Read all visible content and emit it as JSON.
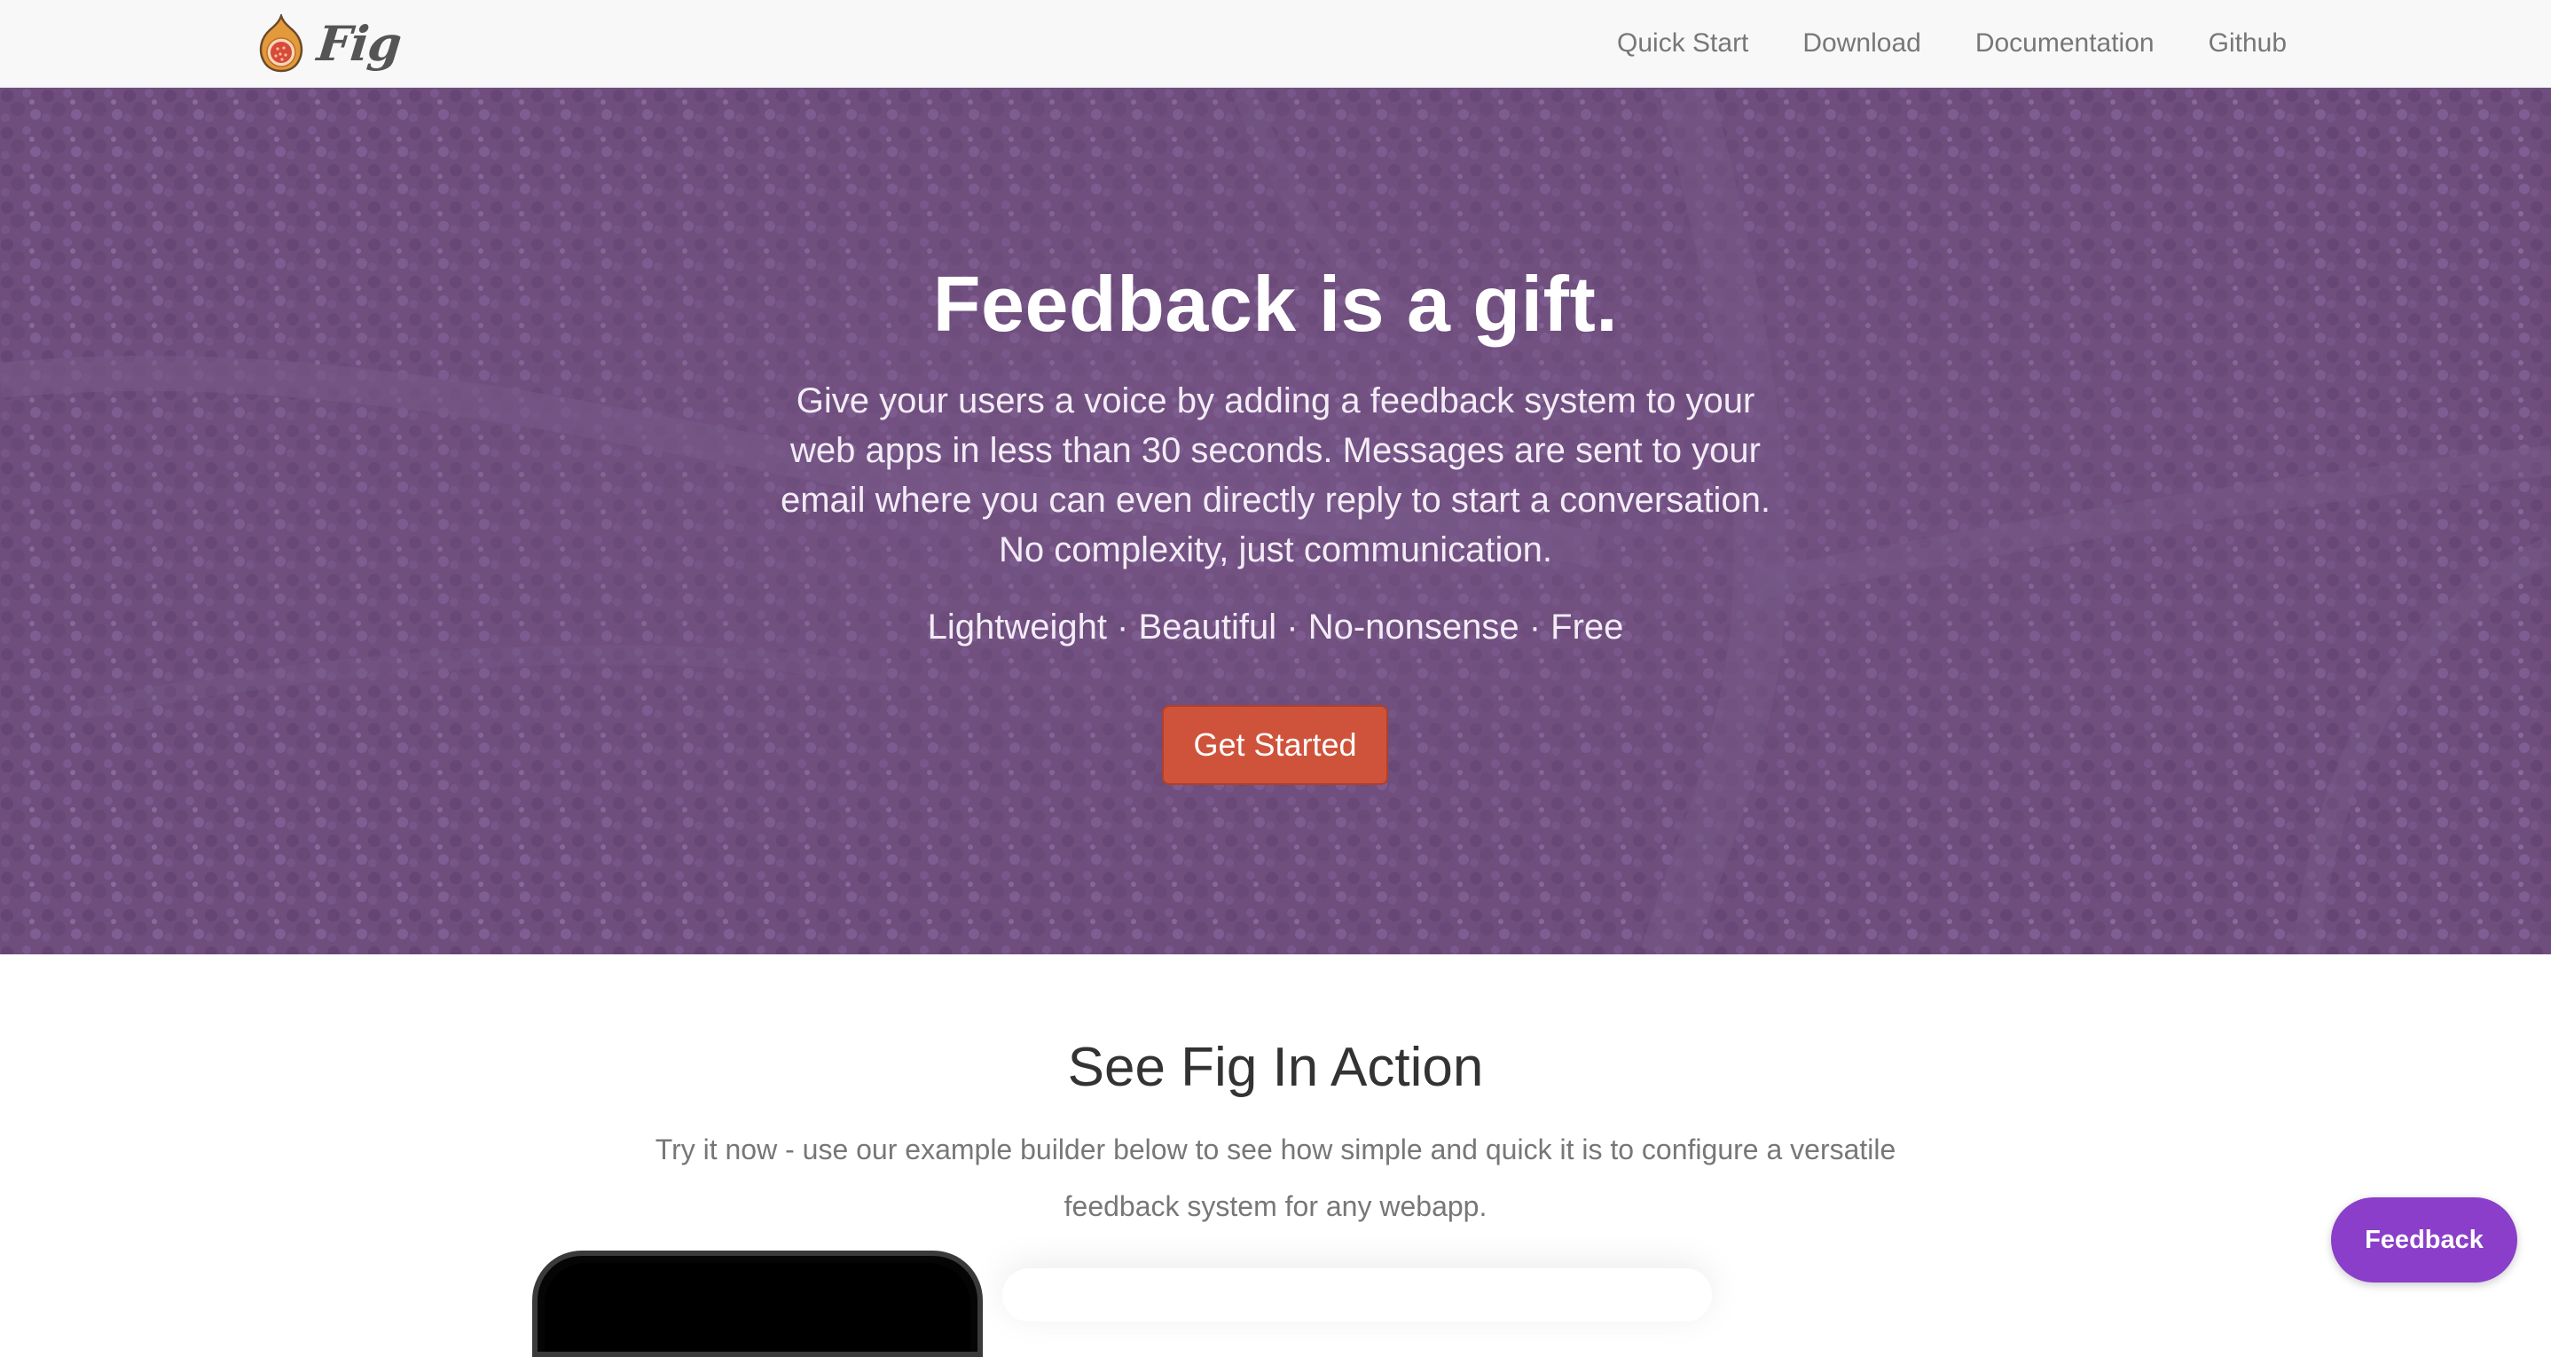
{
  "nav": {
    "brand_name": "Fig",
    "logo_icon": "fig-fruit-icon",
    "links": [
      {
        "label": "Quick Start"
      },
      {
        "label": "Download"
      },
      {
        "label": "Documentation"
      },
      {
        "label": "Github"
      }
    ]
  },
  "hero": {
    "title": "Feedback is a gift.",
    "lead": "Give your users a voice by adding a feedback system to your web apps in less than 30 seconds. Messages are sent to your email where you can even directly reply to start a conversation. No complexity, just communication.",
    "tagline": "Lightweight · Beautiful · No-nonsense · Free",
    "cta_label": "Get Started",
    "background": "tree-canopy-photo",
    "overlay_color": "#6f4f7e"
  },
  "demo_section": {
    "title": "See Fig In Action",
    "description": "Try it now - use our example builder below to see how simple and quick it is to configure a versatile feedback system for any webapp."
  },
  "feedback_widget": {
    "label": "Feedback",
    "color": "#8a3ec9"
  },
  "colors": {
    "cta": "#cf533b",
    "nav_text": "#777777",
    "heading": "#333333"
  }
}
